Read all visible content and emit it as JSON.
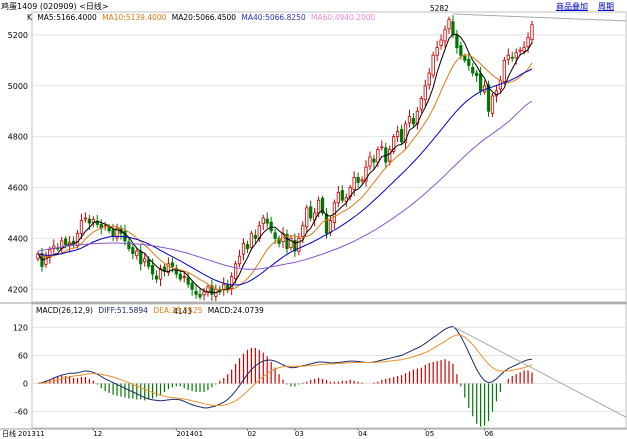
{
  "header": {
    "title": "鸡蛋1409 (020909) <日线>",
    "btn_overlay": "商品叠加",
    "btn_cycle": "周期"
  },
  "legend": {
    "k": "K",
    "ma5": "MA5:5166.4000",
    "ma10": "MA10:5139.4000",
    "ma20": "MA20:5066.4500",
    "ma40": "MA40:5066.8250",
    "ma60": "MA60:4940.2000"
  },
  "macd_legend": {
    "name": "MACD(26,12,9)",
    "diff": "DIFF:51.5894",
    "dea": "DEA:39.5525",
    "macd": "MACD:24.0739"
  },
  "colors": {
    "up": "#cc0000",
    "down": "#007700",
    "ma5": "#000000",
    "ma10": "#e07a14",
    "ma20": "#0000c0",
    "ma40": "#8855cc",
    "ma60": "#ee88dd",
    "diff": "#1a2a66",
    "dea": "#f0902a"
  },
  "chart_data": [
    {
      "type": "candlestick",
      "ylim": [
        4150,
        5290
      ],
      "y_ticks": [
        "5200",
        "5000",
        "4800",
        "4600",
        "4400",
        "4200"
      ],
      "y_tick_values": [
        5200,
        5000,
        4800,
        4600,
        4400,
        4200
      ],
      "x_labels": [
        {
          "label": "日线",
          "index": 0
        },
        {
          "label": "201311",
          "index": 0
        },
        {
          "label": "12",
          "index": 14
        },
        {
          "label": "201401",
          "index": 35
        },
        {
          "label": "02",
          "index": 53
        },
        {
          "label": "03",
          "index": 65
        },
        {
          "label": "04",
          "index": 81
        },
        {
          "label": "05",
          "index": 98
        },
        {
          "label": "06",
          "index": 113
        }
      ],
      "annotations": [
        {
          "text": "5282",
          "index": 105,
          "value": 5282
        },
        {
          "text": "4143",
          "index": 40,
          "value": 4143
        }
      ],
      "closes": [
        4340,
        4290,
        4330,
        4355,
        4370,
        4360,
        4390,
        4375,
        4385,
        4380,
        4420,
        4470,
        4480,
        4460,
        4475,
        4455,
        4440,
        4450,
        4430,
        4410,
        4440,
        4420,
        4390,
        4360,
        4340,
        4350,
        4300,
        4320,
        4290,
        4260,
        4240,
        4280,
        4270,
        4300,
        4290,
        4260,
        4240,
        4250,
        4220,
        4200,
        4180,
        4170,
        4190,
        4210,
        4180,
        4200,
        4190,
        4220,
        4200,
        4250,
        4300,
        4330,
        4380,
        4360,
        4420,
        4400,
        4450,
        4480,
        4460,
        4430,
        4400,
        4380,
        4420,
        4360,
        4400,
        4350,
        4400,
        4450,
        4520,
        4480,
        4500,
        4550,
        4500,
        4420,
        4470,
        4540,
        4580,
        4550,
        4560,
        4600,
        4640,
        4620,
        4630,
        4680,
        4720,
        4700,
        4750,
        4760,
        4700,
        4750,
        4800,
        4820,
        4780,
        4850,
        4880,
        4850,
        4900,
        4950,
        5000,
        5050,
        5120,
        5150,
        5180,
        5220,
        5260,
        5200,
        5150,
        5120,
        5100,
        5080,
        5050,
        5040,
        4980,
        5000,
        4900,
        4960,
        4980,
        5020,
        5100,
        5120,
        5110,
        5130,
        5140,
        5150,
        5190,
        5240
      ],
      "series": [
        {
          "name": "MA5",
          "values": [
            4340,
            4315,
            4320,
            4329,
            4337,
            4341,
            4361,
            4368,
            4378,
            4378,
            4386,
            4406,
            4428,
            4443,
            4461,
            4468,
            4462,
            4456,
            4450,
            4437,
            4434,
            4430,
            4418,
            4404,
            4382,
            4362,
            4348,
            4342,
            4320,
            4306,
            4290,
            4278,
            4272,
            4270,
            4276,
            4276,
            4272,
            4268,
            4252,
            4234,
            4218,
            4204,
            4194,
            4190,
            4188,
            4186,
            4194,
            4200,
            4198,
            4212,
            4232,
            4260,
            4296,
            4324,
            4358,
            4378,
            4402,
            4422,
            4436,
            4444,
            4444,
            4430,
            4418,
            4398,
            4392,
            4382,
            4386,
            4392,
            4424,
            4440,
            4470,
            4500,
            4510,
            4490,
            4488,
            4496,
            4512,
            4526,
            4540,
            4566,
            4586,
            4594,
            4610,
            4634,
            4658,
            4670,
            4696,
            4722,
            4726,
            4732,
            4752,
            4766,
            4770,
            4784,
            4826,
            4836,
            4852,
            4886,
            4916,
            4950,
            4994,
            5054,
            5100,
            5144,
            5186,
            5202,
            5202,
            5190,
            5166,
            5130,
            5100,
            5078,
            5050,
            5030,
            4994,
            4976,
            4964,
            4972,
            4992,
            5036,
            5066,
            5096,
            5122,
            5130,
            5142,
            5170
          ]
        },
        {
          "name": "MA10",
          "values": [
            4340,
            4330,
            4328,
            4330,
            4332,
            4336,
            4342,
            4350,
            4358,
            4362,
            4366,
            4380,
            4398,
            4412,
            4425,
            4434,
            4440,
            4448,
            4448,
            4447,
            4445,
            4440,
            4434,
            4425,
            4414,
            4400,
            4388,
            4374,
            4360,
            4344,
            4328,
            4314,
            4302,
            4292,
            4284,
            4280,
            4276,
            4272,
            4266,
            4258,
            4248,
            4238,
            4230,
            4220,
            4210,
            4202,
            4197,
            4197,
            4196,
            4199,
            4206,
            4216,
            4228,
            4242,
            4260,
            4282,
            4306,
            4332,
            4356,
            4374,
            4386,
            4396,
            4404,
            4408,
            4410,
            4408,
            4406,
            4404,
            4408,
            4414,
            4428,
            4446,
            4464,
            4472,
            4478,
            4486,
            4494,
            4504,
            4512,
            4522,
            4534,
            4548,
            4562,
            4580,
            4600,
            4620,
            4640,
            4660,
            4678,
            4694,
            4710,
            4724,
            4736,
            4750,
            4770,
            4790,
            4810,
            4832,
            4856,
            4880,
            4910,
            4944,
            4980,
            5014,
            5048,
            5078,
            5100,
            5114,
            5122,
            5120,
            5112,
            5100,
            5086,
            5070,
            5056,
            5042,
            5030,
            5020,
            5012,
            5012,
            5016,
            5024,
            5036,
            5050,
            5066,
            5090
          ]
        },
        {
          "name": "MA20",
          "values": [
            4340,
            4336,
            4334,
            4334,
            4335,
            4337,
            4340,
            4344,
            4348,
            4352,
            4356,
            4362,
            4370,
            4378,
            4386,
            4392,
            4398,
            4402,
            4406,
            4408,
            4408,
            4408,
            4406,
            4404,
            4400,
            4396,
            4391,
            4385,
            4378,
            4370,
            4362,
            4353,
            4345,
            4336,
            4328,
            4320,
            4312,
            4303,
            4294,
            4285,
            4276,
            4267,
            4258,
            4250,
            4242,
            4235,
            4229,
            4224,
            4220,
            4218,
            4217,
            4218,
            4222,
            4228,
            4236,
            4246,
            4256,
            4268,
            4280,
            4292,
            4304,
            4316,
            4327,
            4337,
            4346,
            4354,
            4361,
            4368,
            4375,
            4382,
            4390,
            4398,
            4407,
            4415,
            4424,
            4433,
            4442,
            4452,
            4462,
            4473,
            4484,
            4496,
            4508,
            4521,
            4535,
            4549,
            4563,
            4578,
            4593,
            4608,
            4623,
            4638,
            4653,
            4668,
            4684,
            4700,
            4717,
            4734,
            4752,
            4770,
            4789,
            4808,
            4827,
            4846,
            4866,
            4884,
            4902,
            4918,
            4933,
            4946,
            4958,
            4968,
            4977,
            4985,
            4991,
            4996,
            5001,
            5006,
            5012,
            5018,
            5025,
            5033,
            5042,
            5051,
            5058,
            5066
          ]
        },
        {
          "name": "MA40",
          "values": [
            4350,
            4353,
            4356,
            4359,
            4362,
            4364,
            4367,
            4369,
            4371,
            4373,
            4374,
            4376,
            4377,
            4378,
            4379,
            4380,
            4381,
            4381,
            4382,
            4382,
            4382,
            4381,
            4381,
            4380,
            4379,
            4378,
            4377,
            4375,
            4373,
            4371,
            4369,
            4366,
            4363,
            4360,
            4357,
            4353,
            4349,
            4345,
            4341,
            4336,
            4331,
            4326,
            4321,
            4316,
            4311,
            4306,
            4301,
            4296,
            4292,
            4288,
            4285,
            4282,
            4280,
            4279,
            4279,
            4279,
            4280,
            4282,
            4285,
            4288,
            4291,
            4294,
            4297,
            4300,
            4303,
            4306,
            4310,
            4314,
            4318,
            4323,
            4328,
            4333,
            4338,
            4344,
            4350,
            4356,
            4362,
            4368,
            4375,
            4382,
            4389,
            4397,
            4405,
            4413,
            4422,
            4431,
            4440,
            4450,
            4460,
            4470,
            4481,
            4492,
            4503,
            4514,
            4526,
            4538,
            4551,
            4564,
            4577,
            4591,
            4605,
            4619,
            4634,
            4649,
            4664,
            4679,
            4694,
            4709,
            4724,
            4738,
            4752,
            4765,
            4778,
            4790,
            4801,
            4812,
            4823,
            4834,
            4846,
            4858,
            4872,
            4887,
            4902,
            4918,
            4930,
            4940
          ]
        }
      ]
    },
    {
      "type": "macd",
      "ylim": [
        -95,
        140
      ],
      "y_ticks": [
        "120",
        "60",
        "0",
        "-60"
      ],
      "y_tick_values": [
        120,
        60,
        0,
        -60
      ],
      "series": [
        {
          "name": "DIFF",
          "values": [
            0,
            2,
            5,
            8,
            12,
            15,
            18,
            20,
            22,
            22,
            23,
            25,
            27,
            26,
            24,
            20,
            15,
            10,
            6,
            2,
            -2,
            -6,
            -10,
            -14,
            -18,
            -22,
            -26,
            -30,
            -33,
            -35,
            -36,
            -37,
            -36,
            -35,
            -34,
            -34,
            -35,
            -38,
            -42,
            -45,
            -48,
            -50,
            -52,
            -52,
            -50,
            -48,
            -44,
            -40,
            -34,
            -26,
            -16,
            -4,
            8,
            20,
            30,
            38,
            44,
            48,
            50,
            50,
            48,
            44,
            40,
            36,
            34,
            34,
            36,
            38,
            40,
            42,
            44,
            46,
            46,
            45,
            44,
            44,
            45,
            46,
            47,
            48,
            48,
            47,
            46,
            45,
            45,
            46,
            48,
            50,
            52,
            54,
            56,
            58,
            60,
            64,
            68,
            72,
            76,
            80,
            86,
            92,
            98,
            104,
            110,
            116,
            120,
            122,
            114,
            100,
            84,
            66,
            48,
            30,
            16,
            6,
            2,
            4,
            10,
            18,
            26,
            32,
            36,
            40,
            44,
            48,
            51,
            52
          ]
        },
        {
          "name": "DEA",
          "values": [
            0,
            1,
            2,
            4,
            6,
            8,
            10,
            12,
            14,
            16,
            17,
            18,
            20,
            21,
            21,
            21,
            20,
            18,
            16,
            14,
            11,
            8,
            5,
            2,
            -2,
            -5,
            -9,
            -12,
            -16,
            -19,
            -22,
            -25,
            -27,
            -29,
            -30,
            -31,
            -32,
            -33,
            -35,
            -37,
            -39,
            -41,
            -43,
            -45,
            -46,
            -47,
            -47,
            -46,
            -44,
            -41,
            -37,
            -31,
            -24,
            -16,
            -8,
            0,
            8,
            15,
            21,
            27,
            31,
            34,
            36,
            37,
            37,
            37,
            37,
            37,
            38,
            38,
            39,
            40,
            41,
            41,
            42,
            42,
            43,
            43,
            44,
            44,
            45,
            45,
            45,
            45,
            45,
            45,
            46,
            46,
            47,
            48,
            49,
            50,
            51,
            53,
            55,
            57,
            60,
            63,
            66,
            70,
            75,
            80,
            85,
            90,
            96,
            101,
            104,
            103,
            99,
            92,
            83,
            73,
            62,
            51,
            42,
            34,
            29,
            27,
            26,
            27,
            28,
            30,
            32,
            34,
            37,
            40
          ]
        }
      ],
      "histogram": [
        0,
        2,
        6,
        8,
        12,
        14,
        16,
        16,
        16,
        12,
        12,
        14,
        14,
        10,
        6,
        -2,
        -10,
        -16,
        -20,
        -24,
        -26,
        -28,
        -30,
        -32,
        -32,
        -34,
        -34,
        -36,
        -34,
        -32,
        -28,
        -24,
        -18,
        -12,
        -8,
        -6,
        -6,
        -10,
        -14,
        -16,
        -18,
        -18,
        -18,
        -14,
        -8,
        -2,
        6,
        12,
        20,
        30,
        42,
        54,
        64,
        72,
        76,
        76,
        72,
        66,
        58,
        46,
        34,
        20,
        8,
        -2,
        -6,
        -6,
        -2,
        2,
        4,
        8,
        10,
        12,
        10,
        8,
        4,
        4,
        4,
        6,
        6,
        8,
        6,
        4,
        2,
        0,
        0,
        2,
        4,
        8,
        10,
        12,
        14,
        16,
        18,
        22,
        26,
        30,
        32,
        34,
        40,
        44,
        46,
        48,
        50,
        52,
        48,
        42,
        20,
        -6,
        -30,
        -52,
        -70,
        -86,
        -92,
        -90,
        -80,
        -60,
        -38,
        -18,
        0,
        10,
        16,
        20,
        24,
        28,
        28,
        24
      ]
    }
  ]
}
